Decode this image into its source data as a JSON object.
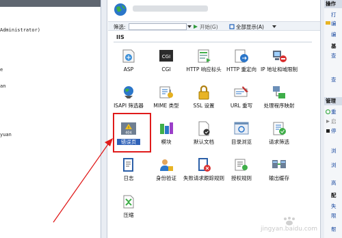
{
  "connections": {
    "tree_lines": [
      {
        "text": "Administrator)"
      },
      {
        "text": "e"
      },
      {
        "text": "an"
      },
      {
        "text": "yuan"
      }
    ]
  },
  "center": {
    "filter_label": "筛选:",
    "go_label": "开始(G)",
    "show_all_label": "全部显示(A)",
    "group_title": "IIS",
    "features": [
      {
        "label": "ASP",
        "icon": "asp-icon"
      },
      {
        "label": "CGI",
        "icon": "cgi-icon"
      },
      {
        "label": "HTTP 响应标头",
        "icon": "http-response-headers-icon"
      },
      {
        "label": "HTTP 重定向",
        "icon": "http-redirect-icon"
      },
      {
        "label": "IP 地址和域限制",
        "icon": "ip-domain-restrictions-icon"
      },
      {
        "label": "ISAPI 筛选器",
        "icon": "isapi-filters-icon"
      },
      {
        "label": "MIME 类型",
        "icon": "mime-types-icon"
      },
      {
        "label": "SSL 设置",
        "icon": "ssl-settings-icon"
      },
      {
        "label": "URL 重写",
        "icon": "url-rewrite-icon"
      },
      {
        "label": "处理程序映射",
        "icon": "handler-mappings-icon"
      },
      {
        "label": "错误页",
        "icon": "error-pages-icon"
      },
      {
        "label": "模块",
        "icon": "modules-icon"
      },
      {
        "label": "默认文档",
        "icon": "default-document-icon"
      },
      {
        "label": "目录浏览",
        "icon": "directory-browsing-icon"
      },
      {
        "label": "请求筛选",
        "icon": "request-filtering-icon"
      },
      {
        "label": "日志",
        "icon": "logging-icon"
      },
      {
        "label": "身份验证",
        "icon": "authentication-icon"
      },
      {
        "label": "失败请求跟踪规则",
        "icon": "failed-request-tracing-icon"
      },
      {
        "label": "授权规则",
        "icon": "authorization-rules-icon"
      },
      {
        "label": "输出缓存",
        "icon": "output-caching-icon"
      },
      {
        "label": "压缩",
        "icon": "compression-icon"
      }
    ]
  },
  "actions": {
    "header_top": "操作",
    "header_manage": "管理",
    "items": [
      "打",
      "编",
      "编",
      "基",
      "查",
      "查",
      "重",
      "启",
      "停",
      "浏",
      "浏",
      "高",
      "配",
      "失",
      "限",
      "帮"
    ]
  },
  "watermark": "jingyan.baidu.com"
}
